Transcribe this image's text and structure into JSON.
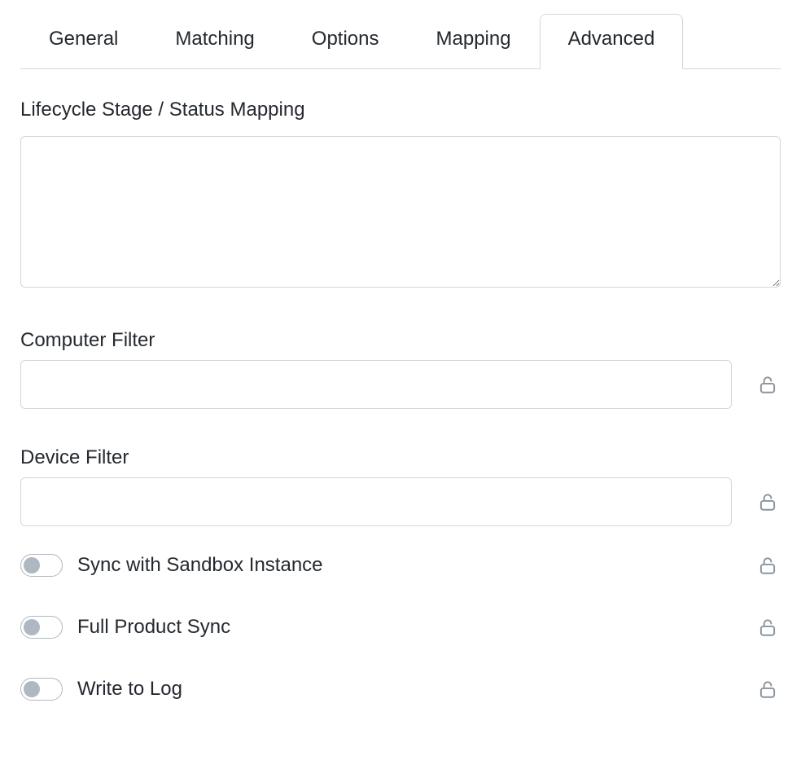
{
  "tabs": {
    "general": {
      "label": "General",
      "active": false
    },
    "matching": {
      "label": "Matching",
      "active": false
    },
    "options": {
      "label": "Options",
      "active": false
    },
    "mapping": {
      "label": "Mapping",
      "active": false
    },
    "advanced": {
      "label": "Advanced",
      "active": true
    }
  },
  "fields": {
    "lifecycle": {
      "label": "Lifecycle Stage / Status Mapping",
      "value": ""
    },
    "computer_filter": {
      "label": "Computer Filter",
      "value": ""
    },
    "device_filter": {
      "label": "Device Filter",
      "value": ""
    }
  },
  "toggles": {
    "sandbox": {
      "label": "Sync with Sandbox Instance",
      "on": false
    },
    "full_sync": {
      "label": "Full Product Sync",
      "on": false
    },
    "write_log": {
      "label": "Write to Log",
      "on": false
    }
  }
}
